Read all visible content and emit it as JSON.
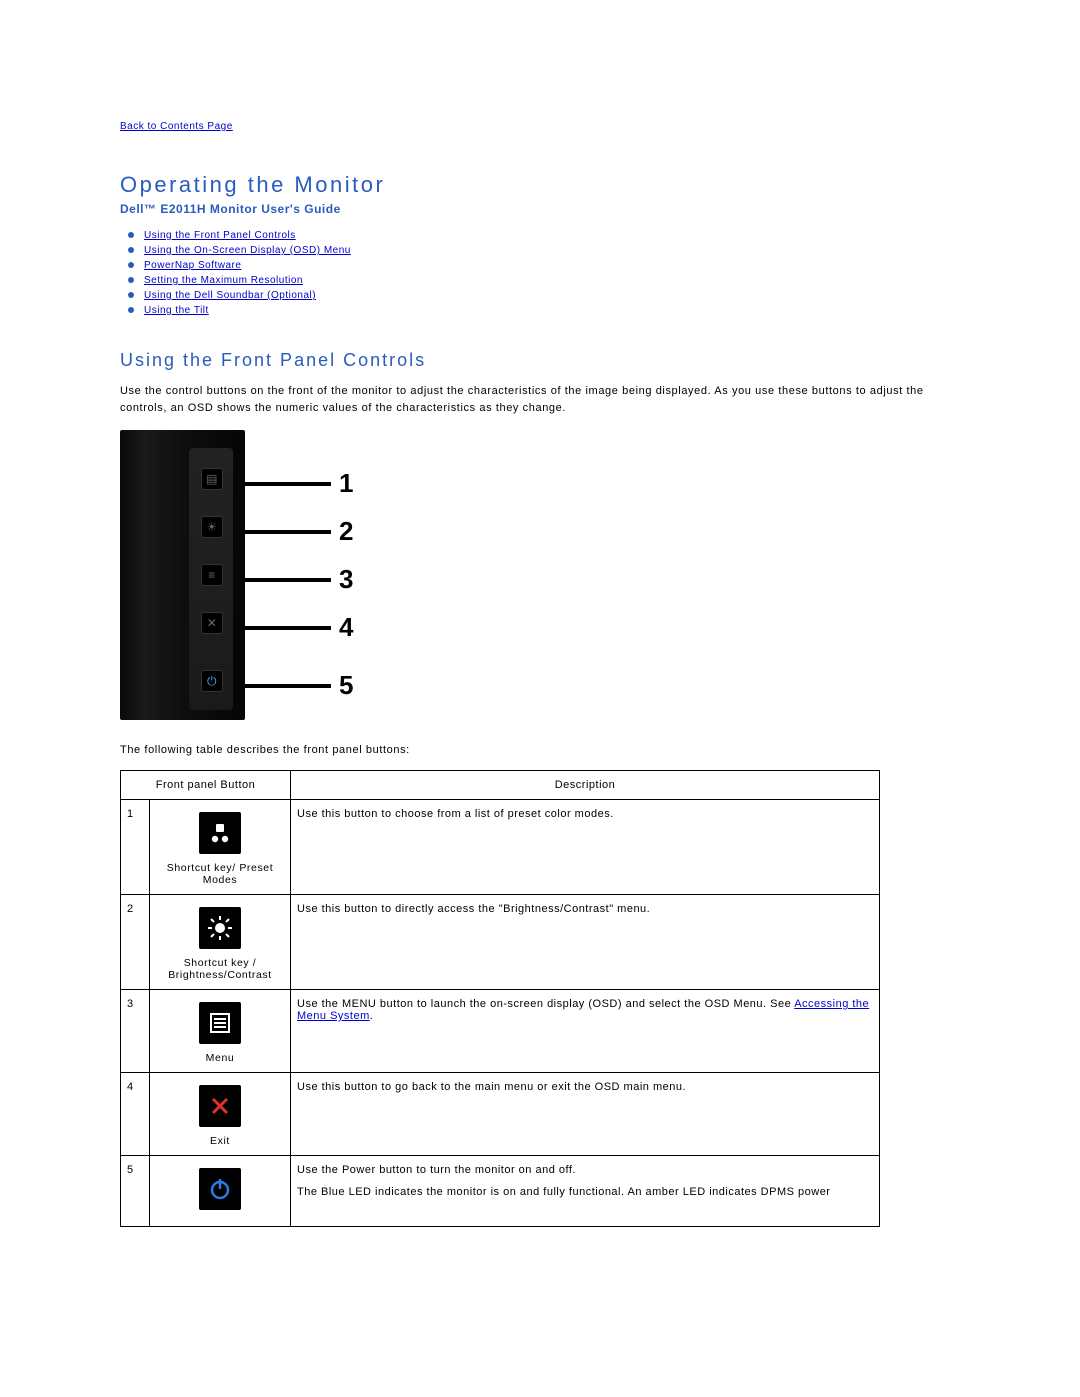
{
  "nav": {
    "back": "Back to Contents Page"
  },
  "header": {
    "title": "Operating the Monitor",
    "subtitle": "Dell™ E2011H Monitor User's Guide"
  },
  "toc": [
    "Using the Front Panel Controls",
    "Using the On-Screen Display (OSD) Menu",
    "PowerNap Software",
    "Setting the Maximum Resolution",
    "Using the Dell Soundbar (Optional)",
    "Using the Tilt"
  ],
  "section": {
    "title": "Using the Front Panel Controls",
    "intro": "Use the control buttons on the front of the monitor to adjust the characteristics of the image being displayed. As you use these buttons to adjust the controls, an OSD shows the numeric values of the characteristics as they change."
  },
  "diagram": {
    "labels": [
      "1",
      "2",
      "3",
      "4",
      "5"
    ]
  },
  "table": {
    "intro": "The following table describes the front panel buttons:",
    "headers": {
      "col1": "Front panel Button",
      "col2": "Description"
    },
    "rows": [
      {
        "n": "1",
        "label": "Shortcut key/ Preset Modes",
        "desc": "Use this button to choose from a list of preset color modes."
      },
      {
        "n": "2",
        "label": "Shortcut key / Brightness/Contrast",
        "desc": "Use this button to directly access the \"Brightness/Contrast\" menu."
      },
      {
        "n": "3",
        "label": "Menu",
        "desc_pre": "Use the MENU button to launch the on-screen display (OSD) and select the OSD Menu. See ",
        "link": "Accessing the Menu System",
        "desc_post": "."
      },
      {
        "n": "4",
        "label": "Exit",
        "desc": "Use this button to go back to the main menu or exit the OSD main menu."
      },
      {
        "n": "5",
        "label": "",
        "desc_line1": "Use the Power button to turn the monitor on and off.",
        "desc_line2": "The Blue LED indicates the monitor is on and fully functional. An amber LED indicates DPMS power"
      }
    ]
  }
}
